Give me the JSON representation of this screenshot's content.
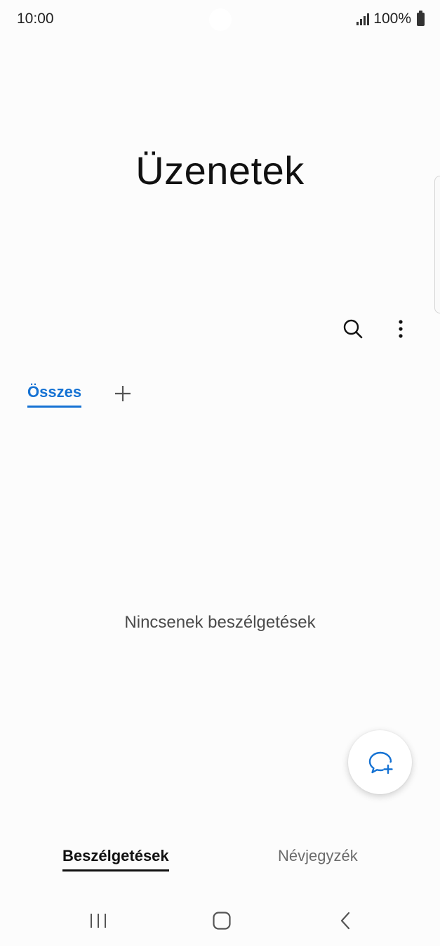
{
  "status_bar": {
    "time": "10:00",
    "battery": "100%"
  },
  "header": {
    "title": "Üzenetek"
  },
  "actions": {
    "search_icon": "search-icon",
    "more_icon": "more-vert-icon"
  },
  "tabs": {
    "all_label": "Összes",
    "add_icon": "plus-icon"
  },
  "main": {
    "empty_text": "Nincsenek beszélgetések"
  },
  "fab": {
    "icon": "new-chat-icon"
  },
  "bottom_tabs": {
    "conversations_label": "Beszélgetések",
    "contacts_label": "Névjegyzék"
  },
  "colors": {
    "accent": "#1572d3",
    "background": "#fcfcfc"
  }
}
